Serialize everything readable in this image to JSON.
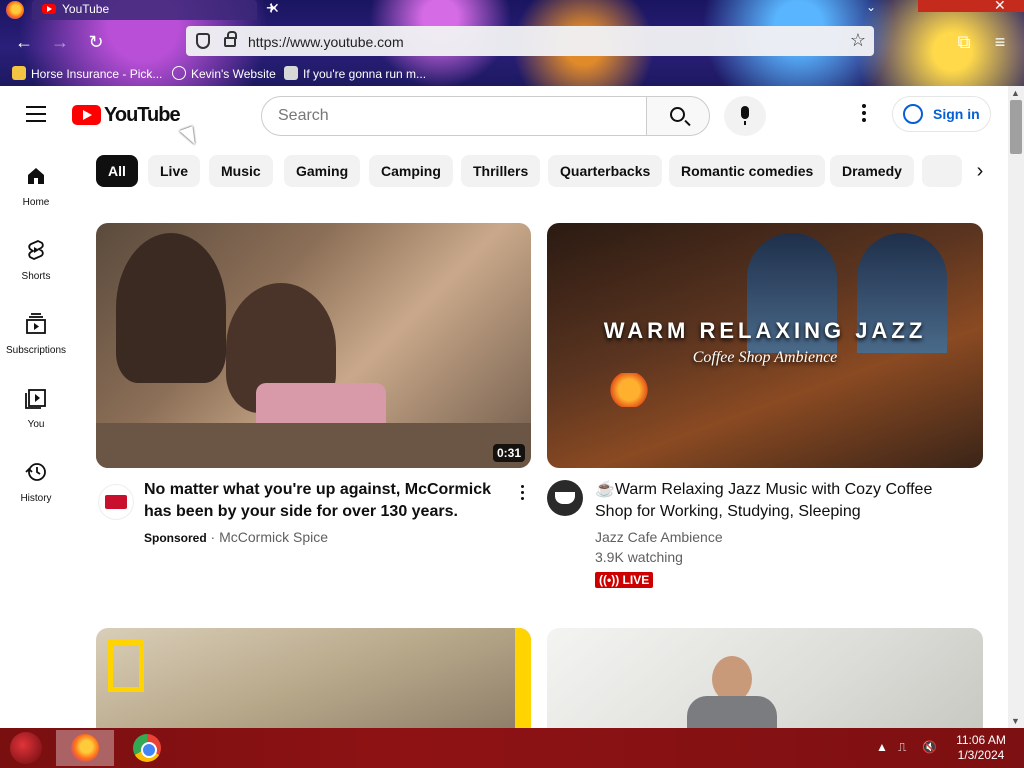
{
  "browser": {
    "tab_title": "YouTube",
    "tab_close": "✕",
    "new_tab": "+",
    "url": "https://www.youtube.com",
    "back": "←",
    "forward": "→",
    "reload": "↻",
    "star": "☆",
    "extensions": "⧉",
    "menu": "≡",
    "list_tabs": "⌄",
    "window_close": "✕",
    "bookmarks": [
      {
        "label": "Horse Insurance - Pick...",
        "icon": "horse-favicon-icon",
        "color": "#f4c542"
      },
      {
        "label": "Kevin's Website",
        "icon": "globe-icon",
        "color": "#ffffff"
      },
      {
        "label": "If you're gonna run m...",
        "icon": "site-favicon-icon",
        "color": "#d8d8d8"
      }
    ]
  },
  "youtube": {
    "logo_text": "YouTube",
    "search": {
      "placeholder": "Search"
    },
    "sign_in": "Sign in",
    "sidebar": [
      {
        "label": "Home",
        "icon": "home-icon"
      },
      {
        "label": "Shorts",
        "icon": "shorts-icon"
      },
      {
        "label": "Subscriptions",
        "icon": "subscriptions-icon"
      },
      {
        "label": "You",
        "icon": "you-icon"
      },
      {
        "label": "History",
        "icon": "history-icon"
      }
    ],
    "chips": [
      "All",
      "Live",
      "Music",
      "Gaming",
      "Camping",
      "Thrillers",
      "Quarterbacks",
      "Romantic comedies",
      "Dramedy"
    ],
    "chip_next": "›",
    "videos": [
      {
        "title": "No matter what you're up against, McCormick has been by your side for over 130 years.",
        "sponsored": "Sponsored",
        "separator": " · ",
        "channel": "McCormick Spice",
        "duration": "0:31"
      },
      {
        "title": "☕Warm Relaxing Jazz Music with Cozy Coffee Shop for Working, Studying, Sleeping",
        "channel": "Jazz Cafe Ambience",
        "watching": "3.9K watching",
        "live": "LIVE",
        "thumb_title": "WARM RELAXING JAZZ",
        "thumb_subtitle": "Coffee Shop Ambience"
      }
    ]
  },
  "taskbar": {
    "time": "11:06 AM",
    "date": "1/3/2024",
    "apps": [
      "Firefox",
      "Chrome"
    ]
  },
  "colors": {
    "accent": "#065fd4",
    "youtube_red": "#ff0000",
    "live_red": "#cc0000"
  }
}
